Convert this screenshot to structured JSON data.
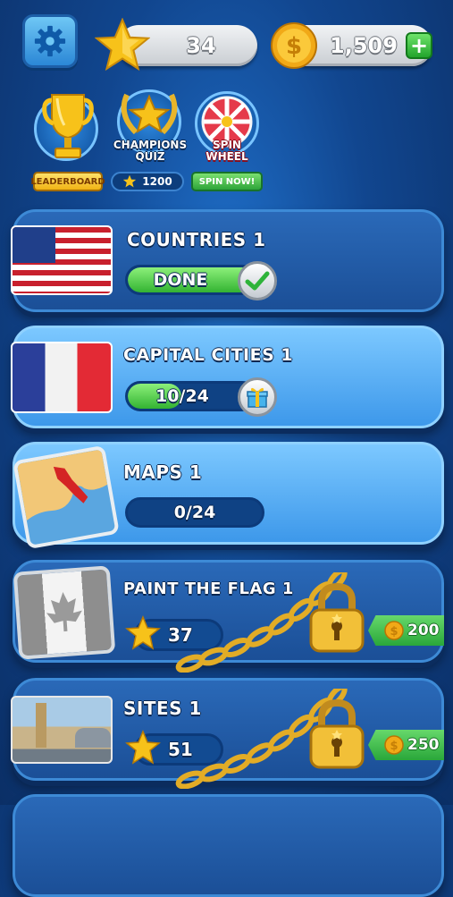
{
  "top_bar": {
    "stars": "34",
    "coins": "1,509",
    "plus": "+"
  },
  "features": {
    "leaderboard_label": "LEADERBOARD",
    "champions_title_1": "CHAMPIONS",
    "champions_title_2": "QUIZ",
    "champions_cost": "1200",
    "spin_title_1": "SPIN",
    "spin_title_2": "WHEEL",
    "spin_button": "SPIN NOW!"
  },
  "levels": [
    {
      "title": "COUNTRIES 1",
      "status": "DONE",
      "progress": 1.0
    },
    {
      "title": "CAPITAL CITIES 1",
      "status": "10/24",
      "progress": 0.4167
    },
    {
      "title": "MAPS 1",
      "status": "0/24",
      "progress": 0.0
    },
    {
      "title": "PAINT THE FLAG 1",
      "star_cost": "37",
      "coin_price": "200",
      "locked": true
    },
    {
      "title": "SITES 1",
      "star_cost": "51",
      "coin_price": "250",
      "locked": true
    }
  ],
  "colors": {
    "accent_green": "#33b332",
    "gold": "#f7c21a",
    "card_dark": "#1b4f97",
    "card_light": "#3d98ea"
  },
  "icons": [
    "gear-icon",
    "star-icon",
    "coin-icon",
    "plus-icon",
    "trophy-icon",
    "spin-wheel-icon",
    "checkmark-icon",
    "gift-icon",
    "padlock-icon",
    "chain-icon"
  ]
}
